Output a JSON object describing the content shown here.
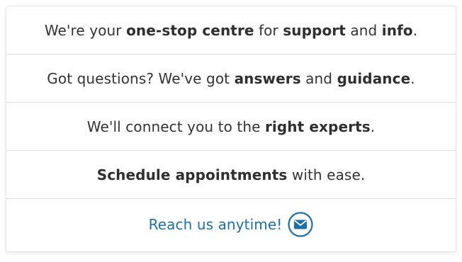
{
  "rows": [
    {
      "parts": [
        {
          "text": "We're your ",
          "bold": false
        },
        {
          "text": "one-stop centre",
          "bold": true
        },
        {
          "text": " for ",
          "bold": false
        },
        {
          "text": "support",
          "bold": true
        },
        {
          "text": " and ",
          "bold": false
        },
        {
          "text": "info",
          "bold": true
        },
        {
          "text": ".",
          "bold": false
        }
      ]
    },
    {
      "parts": [
        {
          "text": "Got questions? We've got ",
          "bold": false
        },
        {
          "text": "answers",
          "bold": true
        },
        {
          "text": " and ",
          "bold": false
        },
        {
          "text": "guidance",
          "bold": true
        },
        {
          "text": ".",
          "bold": false
        }
      ]
    },
    {
      "parts": [
        {
          "text": "We'll connect you to the ",
          "bold": false
        },
        {
          "text": "right experts",
          "bold": true
        },
        {
          "text": ".",
          "bold": false
        }
      ]
    },
    {
      "parts": [
        {
          "text": "Schedule appointments",
          "bold": true
        },
        {
          "text": " with ease.",
          "bold": false
        }
      ]
    }
  ],
  "cta": {
    "label": "Reach us anytime!",
    "icon": "envelope-icon"
  },
  "colors": {
    "accent": "#1d6fa8",
    "text": "#333333",
    "divider": "#dcdcdc"
  }
}
